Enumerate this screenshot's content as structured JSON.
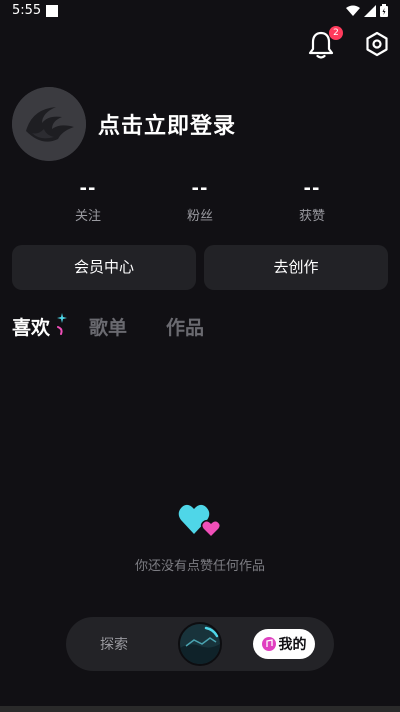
{
  "status_bar": {
    "time": "5:55"
  },
  "header": {
    "notification_count": "2"
  },
  "profile": {
    "login_prompt": "点击立即登录"
  },
  "stats": [
    {
      "value": "--",
      "label": "关注"
    },
    {
      "value": "--",
      "label": "粉丝"
    },
    {
      "value": "--",
      "label": "获赞"
    }
  ],
  "actions": {
    "vip_center": "会员中心",
    "create": "去创作"
  },
  "tabs": [
    {
      "label": "喜欢",
      "active": true
    },
    {
      "label": "歌单",
      "active": false
    },
    {
      "label": "作品",
      "active": false
    }
  ],
  "empty_state": {
    "message": "你还没有点赞任何作品"
  },
  "bottom_nav": {
    "explore": "探索",
    "mine": "我的"
  },
  "colors": {
    "background": "#111014",
    "card": "#222226",
    "badge": "#ff3b5c",
    "heart_cyan": "#4fd6e8",
    "heart_pink": "#f04fb8"
  }
}
